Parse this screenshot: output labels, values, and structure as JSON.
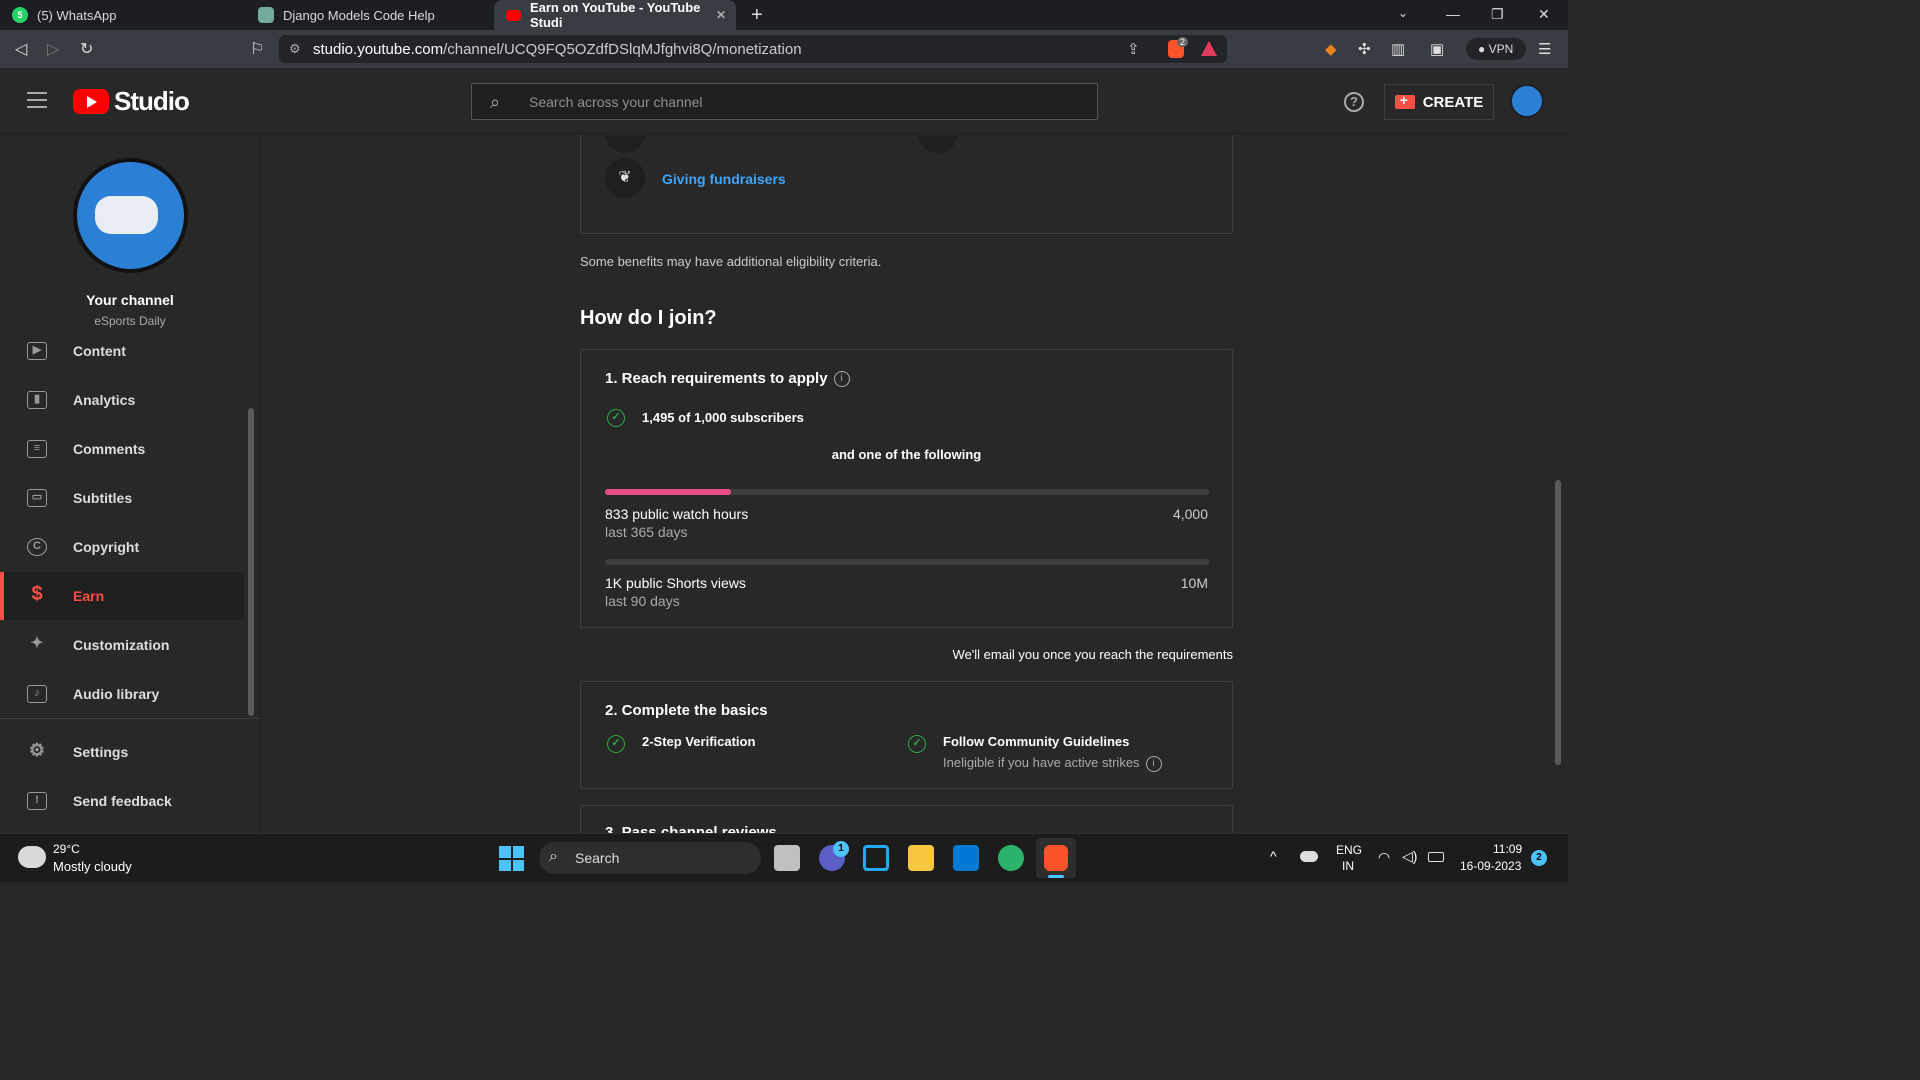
{
  "browser": {
    "tabs": [
      {
        "label": "(5) WhatsApp",
        "icon": "whatsapp-icon",
        "color": "#25d366"
      },
      {
        "label": "Django Models Code Help",
        "icon": "chatgpt-icon",
        "color": "#74aa9c"
      },
      {
        "label": "Earn on YouTube - YouTube Studi",
        "icon": "youtube-icon",
        "color": "#ff0000"
      }
    ],
    "url_host": "studio.youtube.com",
    "url_path": "/channel/UCQ9FQ5OZdfDSlqMJfghvi8Q/monetization",
    "vpn_label": "VPN",
    "brave_badge": "2"
  },
  "header": {
    "logo_text": "Studio",
    "search_placeholder": "Search across your channel",
    "create_label": "CREATE"
  },
  "sidebar": {
    "channel_title": "Your channel",
    "channel_name": "eSports Daily",
    "items": [
      {
        "label": "Content",
        "icon": "content-icon",
        "glyph": "▶"
      },
      {
        "label": "Analytics",
        "icon": "analytics-icon",
        "glyph": "▮"
      },
      {
        "label": "Comments",
        "icon": "comments-icon",
        "glyph": "≡"
      },
      {
        "label": "Subtitles",
        "icon": "subtitles-icon",
        "glyph": "▭"
      },
      {
        "label": "Copyright",
        "icon": "copyright-icon",
        "glyph": "C"
      },
      {
        "label": "Earn",
        "icon": "dollar-icon",
        "glyph": "$"
      },
      {
        "label": "Customization",
        "icon": "wand-icon",
        "glyph": "✦"
      },
      {
        "label": "Audio library",
        "icon": "audio-library-icon",
        "glyph": "♪"
      }
    ],
    "settings_label": "Settings",
    "feedback_label": "Send feedback"
  },
  "main": {
    "benefit_link": "Giving fundraisers",
    "eligibility_note": "Some benefits may have additional eligibility criteria.",
    "join_heading": "How do I join?",
    "step1": {
      "title": "1. Reach requirements to apply",
      "subscribers": "1,495 of 1,000 subscribers",
      "one_of": "and one of the following",
      "watch_label": "833 public watch hours",
      "watch_period": "last 365 days",
      "watch_goal": "4,000",
      "watch_progress": 0.2083,
      "shorts_label": "1K public Shorts views",
      "shorts_period": "last 90 days",
      "shorts_goal": "10M",
      "shorts_progress": 0.0001
    },
    "email_note": "We'll email you once you reach the requirements",
    "step2": {
      "title": "2. Complete the basics",
      "item1": "2-Step Verification",
      "item2": "Follow Community Guidelines",
      "item2_sub": "Ineligible if you have active strikes"
    },
    "step3_title_partial": "3. Pass channel reviews"
  },
  "taskbar": {
    "temp": "29°C",
    "weather": "Mostly cloudy",
    "search_label": "Search",
    "lang1": "ENG",
    "lang2": "IN",
    "time": "11:09",
    "date": "16-09-2023",
    "notif_count": "2",
    "teams_badge": "1"
  },
  "colors": {
    "accent_red": "#ff4e45",
    "link_blue": "#3ea6ff",
    "progress_pink": "#ea4c89",
    "check_green": "#2ba640"
  }
}
